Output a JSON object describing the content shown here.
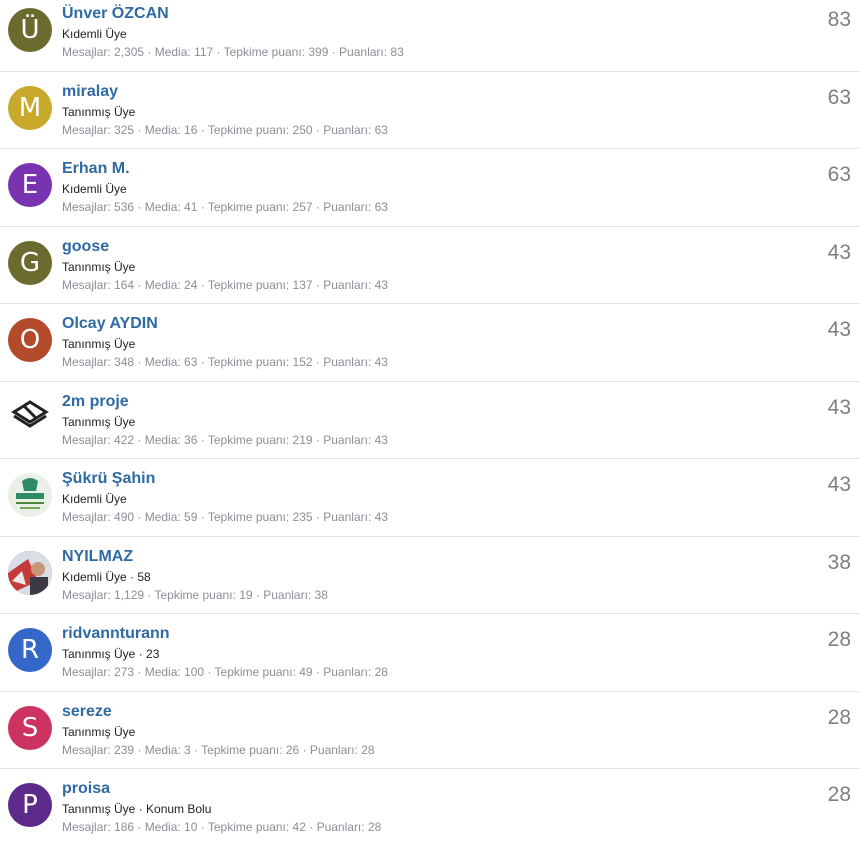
{
  "members": [
    {
      "avatar_letter": "Ü",
      "avatar_color": "#6b6b2f",
      "name": "Ünver ÖZCAN",
      "title": "Kıdemli Üye",
      "stats": "Mesajlar: 2,305 · Media: 117 · Tepkime puanı: 399 · Puanları: 83",
      "points": "83"
    },
    {
      "avatar_letter": "M",
      "avatar_color": "#c9a92a",
      "name": "miralay",
      "title": "Tanınmış Üye",
      "stats": "Mesajlar: 325 · Media: 16 · Tepkime puanı: 250 · Puanları: 63",
      "points": "63"
    },
    {
      "avatar_letter": "E",
      "avatar_color": "#7a33b0",
      "name": "Erhan M.",
      "title": "Kıdemli Üye",
      "stats": "Mesajlar: 536 · Media: 41 · Tepkime puanı: 257 · Puanları: 63",
      "points": "63"
    },
    {
      "avatar_letter": "G",
      "avatar_color": "#6b6b2f",
      "name": "goose",
      "title": "Tanınmış Üye",
      "stats": "Mesajlar: 164 · Media: 24 · Tepkime puanı: 137 · Puanları: 43",
      "points": "43"
    },
    {
      "avatar_letter": "O",
      "avatar_color": "#b34a2a",
      "name": "Olcay AYDIN",
      "title": "Tanınmış Üye",
      "stats": "Mesajlar: 348 · Media: 63 · Tepkime puanı: 152 · Puanları: 43",
      "points": "43"
    },
    {
      "avatar_letter": "",
      "avatar_color": "#ffffff",
      "name": "2m proje",
      "title": "Tanınmış Üye",
      "stats": "Mesajlar: 422 · Media: 36 · Tepkime puanı: 219 · Puanları: 43",
      "points": "43"
    },
    {
      "avatar_letter": "",
      "avatar_color": "#e9f1e6",
      "name": "Şükrü Şahin",
      "title": "Kıdemli Üye",
      "stats": "Mesajlar: 490 · Media: 59 · Tepkime puanı: 235 · Puanları: 43",
      "points": "43"
    },
    {
      "avatar_letter": "",
      "avatar_color": "#c23a3a",
      "name": "NYILMAZ",
      "title": "Kıdemli Üye · 58",
      "stats": "Mesajlar: 1,129 · Tepkime puanı: 19 · Puanları: 38",
      "points": "38"
    },
    {
      "avatar_letter": "R",
      "avatar_color": "#3567c9",
      "name": "ridvannturann",
      "title": "Tanınmış Üye · 23",
      "stats": "Mesajlar: 273 · Media: 100 · Tepkime puanı: 49 · Puanları: 28",
      "points": "28"
    },
    {
      "avatar_letter": "S",
      "avatar_color": "#cc3360",
      "name": "sereze",
      "title": "Tanınmış Üye",
      "stats": "Mesajlar: 239 · Media: 3 · Tepkime puanı: 26 · Puanları: 28",
      "points": "28"
    },
    {
      "avatar_letter": "P",
      "avatar_color": "#5e2a8a",
      "name": "proisa",
      "title": "Tanınmış Üye · Konum Bolu",
      "stats": "Mesajlar: 186 · Media: 10 · Tepkime puanı: 42 · Puanları: 28",
      "points": "28"
    }
  ]
}
